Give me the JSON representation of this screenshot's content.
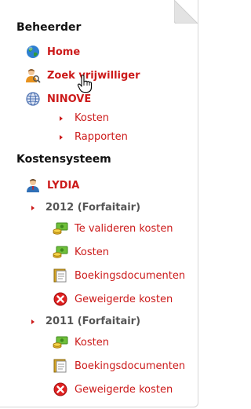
{
  "sections": {
    "beheerder": "Beheerder",
    "kostensysteem": "Kostensysteem"
  },
  "beheerder_items": {
    "home": "Home",
    "zoek": "Zoek vrijwilliger",
    "ninove": "NINOVE",
    "kosten": "Kosten",
    "rapporten": "Rapporten"
  },
  "kosten_items": {
    "lydia": "LYDIA",
    "year2012": "2012 (Forfaitair)",
    "y2012_te_valideren": "Te valideren kosten",
    "y2012_kosten": "Kosten",
    "y2012_boekingsdocumenten": "Boekingsdocumenten",
    "y2012_geweigerde": "Geweigerde kosten",
    "year2011": "2011 (Forfaitair)",
    "y2011_kosten": "Kosten",
    "y2011_boekingsdocumenten": "Boekingsdocumenten",
    "y2011_geweigerde": "Geweigerde kosten"
  },
  "colors": {
    "link": "#cc1a1a",
    "heading": "#111111",
    "year": "#555555"
  },
  "icons": {
    "home": "globe-icon",
    "zoek": "user-search-icon",
    "ninove": "network-globe-icon",
    "lydia": "user-icon",
    "kosten": "money-icon",
    "documenten": "documents-icon",
    "geweigerd": "reject-icon"
  }
}
